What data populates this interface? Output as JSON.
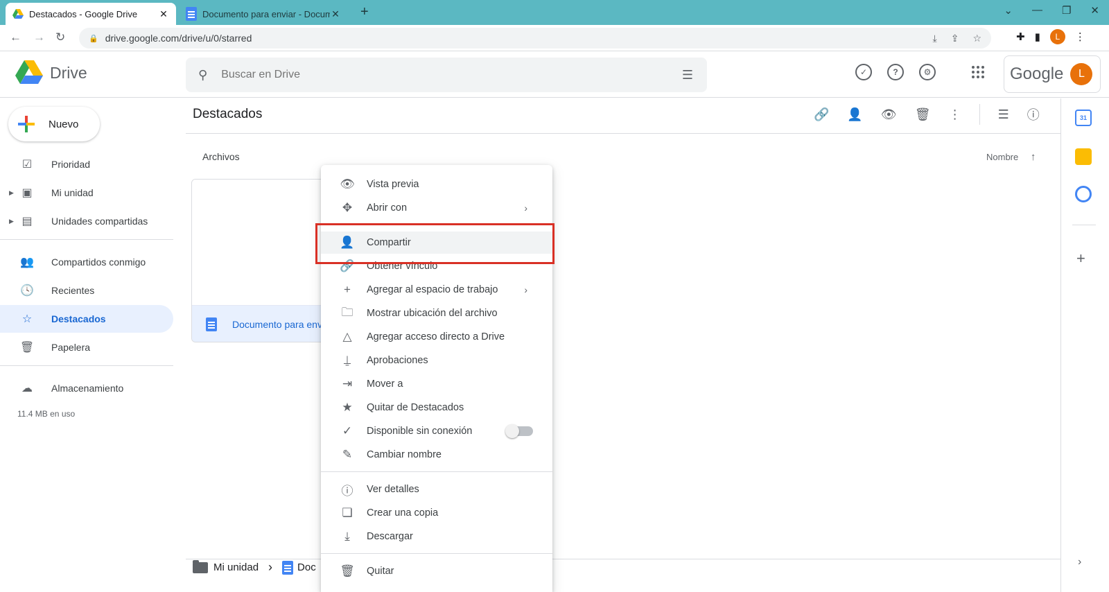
{
  "browser": {
    "tabs": [
      {
        "title": "Destacados - Google Drive",
        "active": true
      },
      {
        "title": "Documento para enviar - Docum",
        "active": false
      }
    ],
    "url": "drive.google.com/drive/u/0/starred",
    "profile_initial": "L"
  },
  "header": {
    "brand": "Drive",
    "search_placeholder": "Buscar en Drive",
    "account_brand": "Google",
    "avatar_initial": "L"
  },
  "sidebar": {
    "new_label": "Nuevo",
    "items": [
      {
        "label": "Prioridad",
        "icon": "check-circle-icon"
      },
      {
        "label": "Mi unidad",
        "icon": "drive-icon"
      },
      {
        "label": "Unidades compartidas",
        "icon": "shared-drives-icon"
      },
      {
        "label": "Compartidos conmigo",
        "icon": "people-icon"
      },
      {
        "label": "Recientes",
        "icon": "clock-icon"
      },
      {
        "label": "Destacados",
        "icon": "star-icon",
        "active": true
      },
      {
        "label": "Papelera",
        "icon": "trash-icon"
      },
      {
        "label": "Almacenamiento",
        "icon": "cloud-icon"
      }
    ],
    "storage_used": "11.4 MB en uso"
  },
  "main": {
    "title": "Destacados",
    "section_label": "Archivos",
    "sort_label": "Nombre",
    "file": {
      "name": "Documento para envi"
    },
    "breadcrumb": {
      "root": "Mi unidad",
      "current": "Doc"
    }
  },
  "rail": {
    "calendar_day": "31"
  },
  "context_menu": {
    "items": [
      {
        "label": "Vista previa",
        "icon": "eye-icon"
      },
      {
        "label": "Abrir con",
        "icon": "move-icon",
        "submenu": true
      },
      {
        "label": "Compartir",
        "icon": "person-add-icon",
        "highlighted": true
      },
      {
        "label": "Obtener vínculo",
        "icon": "link-icon"
      },
      {
        "label": "Agregar al espacio de trabajo",
        "icon": "plus-icon",
        "submenu": true
      },
      {
        "label": "Mostrar ubicación del archivo",
        "icon": "folder-icon"
      },
      {
        "label": "Agregar acceso directo a Drive",
        "icon": "drive-shortcut-icon"
      },
      {
        "label": "Aprobaciones",
        "icon": "stamp-icon"
      },
      {
        "label": "Mover a",
        "icon": "move-to-icon"
      },
      {
        "label": "Quitar de Destacados",
        "icon": "star-filled-icon"
      },
      {
        "label": "Disponible sin conexión",
        "icon": "offline-icon",
        "toggle": false
      },
      {
        "label": "Cambiar nombre",
        "icon": "pencil-icon"
      },
      {
        "label": "Ver detalles",
        "icon": "info-icon"
      },
      {
        "label": "Crear una copia",
        "icon": "copy-icon"
      },
      {
        "label": "Descargar",
        "icon": "download-icon"
      },
      {
        "label": "Quitar",
        "icon": "trash-icon"
      }
    ]
  }
}
